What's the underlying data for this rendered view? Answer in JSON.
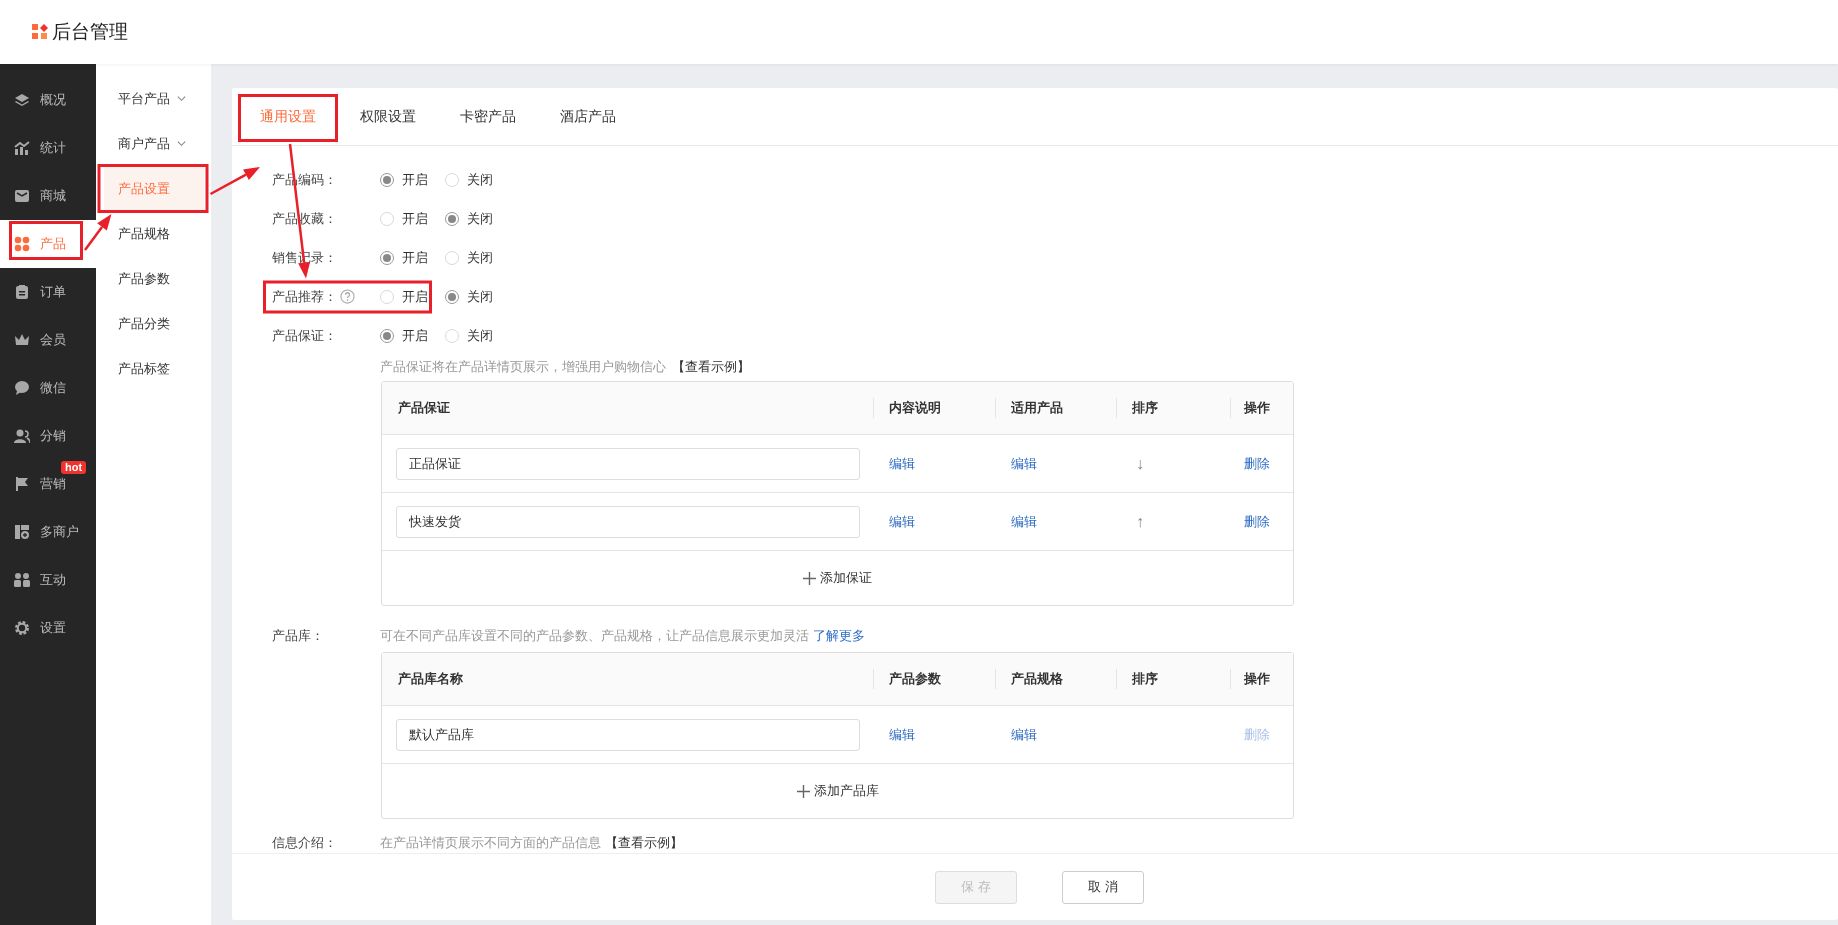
{
  "app": {
    "title": "后台管理"
  },
  "sidebar": {
    "items": [
      {
        "label": "概况",
        "selected": false,
        "highlighted": false
      },
      {
        "label": "统计",
        "selected": false,
        "highlighted": false
      },
      {
        "label": "商城",
        "selected": false,
        "highlighted": false
      },
      {
        "label": "产品",
        "selected": true,
        "highlighted": true
      },
      {
        "label": "订单",
        "selected": false,
        "highlighted": false
      },
      {
        "label": "会员",
        "selected": false,
        "highlighted": false
      },
      {
        "label": "微信",
        "selected": false,
        "highlighted": false
      },
      {
        "label": "分销",
        "selected": false,
        "highlighted": false
      },
      {
        "label": "营销",
        "selected": false,
        "highlighted": false,
        "badge": "hot"
      },
      {
        "label": "多商户",
        "selected": false,
        "highlighted": false
      },
      {
        "label": "互动",
        "selected": false,
        "highlighted": false
      },
      {
        "label": "设置",
        "selected": false,
        "highlighted": false
      }
    ]
  },
  "submenu": {
    "items": [
      {
        "label": "平台产品",
        "kind": "group",
        "selected": false,
        "highlighted": false
      },
      {
        "label": "商户产品",
        "kind": "group",
        "selected": false,
        "highlighted": false
      },
      {
        "label": "产品设置",
        "kind": "item",
        "selected": true,
        "highlighted": true
      },
      {
        "label": "产品规格",
        "kind": "item",
        "selected": false,
        "highlighted": false
      },
      {
        "label": "产品参数",
        "kind": "item",
        "selected": false,
        "highlighted": false
      },
      {
        "label": "产品分类",
        "kind": "item",
        "selected": false,
        "highlighted": false
      },
      {
        "label": "产品标签",
        "kind": "item",
        "selected": false,
        "highlighted": false
      }
    ]
  },
  "tabs": [
    {
      "label": "通用设置",
      "selected": true,
      "highlighted": true
    },
    {
      "label": "权限设置",
      "selected": false,
      "highlighted": false
    },
    {
      "label": "卡密产品",
      "selected": false,
      "highlighted": false
    },
    {
      "label": "酒店产品",
      "selected": false,
      "highlighted": false
    }
  ],
  "settings": [
    {
      "label": "产品编码：",
      "highlighted": false,
      "options": [
        {
          "label": "开启",
          "selected": true
        },
        {
          "label": "关闭",
          "selected": false
        }
      ]
    },
    {
      "label": "产品收藏：",
      "highlighted": false,
      "options": [
        {
          "label": "开启",
          "selected": false
        },
        {
          "label": "关闭",
          "selected": true
        }
      ]
    },
    {
      "label": "销售记录：",
      "highlighted": false,
      "options": [
        {
          "label": "开启",
          "selected": true
        },
        {
          "label": "关闭",
          "selected": false
        }
      ]
    },
    {
      "label": "产品推荐：",
      "help": true,
      "highlighted": true,
      "options": [
        {
          "label": "开启",
          "selected": false
        },
        {
          "label": "关闭",
          "selected": true
        }
      ]
    },
    {
      "label": "产品保证：",
      "highlighted": false,
      "options": [
        {
          "label": "开启",
          "selected": true
        },
        {
          "label": "关闭",
          "selected": false
        }
      ]
    }
  ],
  "guarantee": {
    "note": "产品保证将在产品详情页展示，增强用户购物信心",
    "link": "【查看示例】",
    "table": {
      "columns": [
        "产品保证",
        "内容说明",
        "适用产品",
        "排序",
        "操作"
      ],
      "rows": [
        {
          "name": "正品保证",
          "content": "编辑",
          "products": "编辑",
          "sort": "↓",
          "action": "删除",
          "disabled": false
        },
        {
          "name": "快速发货",
          "content": "编辑",
          "products": "编辑",
          "sort": "↑",
          "action": "删除",
          "disabled": false
        }
      ],
      "add": "添加保证"
    }
  },
  "library": {
    "label": "产品库：",
    "note": "可在不同产品库设置不同的产品参数、产品规格，让产品信息展示更加灵活",
    "link": "了解更多",
    "table": {
      "columns": [
        "产品库名称",
        "产品参数",
        "产品规格",
        "排序",
        "操作"
      ],
      "rows": [
        {
          "name": "默认产品库",
          "content": "编辑",
          "products": "编辑",
          "action": "删除",
          "disabled": true
        }
      ],
      "add": "添加产品库"
    }
  },
  "info": {
    "label": "信息介绍：",
    "note": "在产品详情页展示不同方面的产品信息",
    "link": "【查看示例】"
  },
  "footer": {
    "buttons": [
      {
        "label": "保 存",
        "disabled": true
      },
      {
        "label": "取 消",
        "disabled": false
      }
    ]
  }
}
